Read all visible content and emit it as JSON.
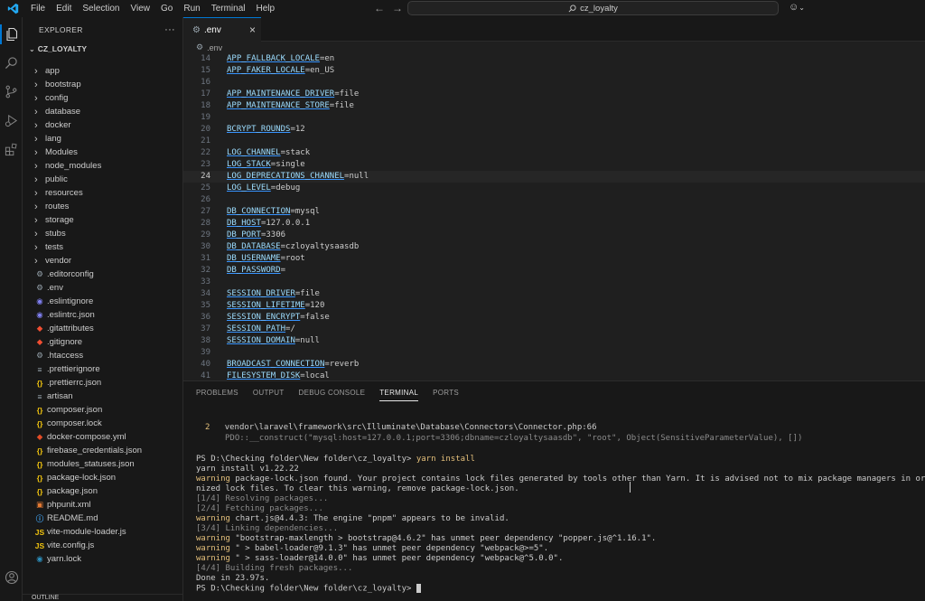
{
  "titlebar": {
    "menu": [
      "File",
      "Edit",
      "Selection",
      "View",
      "Go",
      "Run",
      "Terminal",
      "Help"
    ],
    "search": "cz_loyalty",
    "icons": [
      "vscode-logo-icon",
      "arrow-left-icon",
      "arrow-right-icon",
      "search-icon",
      "copilot-icon",
      "chevron-down-icon"
    ]
  },
  "sidebar": {
    "title": "EXPLORER",
    "more": "···",
    "root": "CZ_LOYALTY",
    "items": [
      {
        "label": "app",
        "type": "folder"
      },
      {
        "label": "bootstrap",
        "type": "folder"
      },
      {
        "label": "config",
        "type": "folder"
      },
      {
        "label": "database",
        "type": "folder"
      },
      {
        "label": "docker",
        "type": "folder"
      },
      {
        "label": "lang",
        "type": "folder"
      },
      {
        "label": "Modules",
        "type": "folder"
      },
      {
        "label": "node_modules",
        "type": "folder"
      },
      {
        "label": "public",
        "type": "folder"
      },
      {
        "label": "resources",
        "type": "folder"
      },
      {
        "label": "routes",
        "type": "folder"
      },
      {
        "label": "storage",
        "type": "folder"
      },
      {
        "label": "stubs",
        "type": "folder"
      },
      {
        "label": "tests",
        "type": "folder"
      },
      {
        "label": "vendor",
        "type": "folder"
      },
      {
        "label": ".editorconfig",
        "type": "gear"
      },
      {
        "label": ".env",
        "type": "gear"
      },
      {
        "label": ".eslintignore",
        "type": "eslint"
      },
      {
        "label": ".eslintrc.json",
        "type": "eslint"
      },
      {
        "label": ".gitattributes",
        "type": "git"
      },
      {
        "label": ".gitignore",
        "type": "git"
      },
      {
        "label": ".htaccess",
        "type": "gear"
      },
      {
        "label": ".prettierignore",
        "type": "lines"
      },
      {
        "label": ".prettierrc.json",
        "type": "json"
      },
      {
        "label": "artisan",
        "type": "lines"
      },
      {
        "label": "composer.json",
        "type": "json"
      },
      {
        "label": "composer.lock",
        "type": "json"
      },
      {
        "label": "docker-compose.yml",
        "type": "yml"
      },
      {
        "label": "firebase_credentials.json",
        "type": "json"
      },
      {
        "label": "modules_statuses.json",
        "type": "json"
      },
      {
        "label": "package-lock.json",
        "type": "json"
      },
      {
        "label": "package.json",
        "type": "json"
      },
      {
        "label": "phpunit.xml",
        "type": "xml"
      },
      {
        "label": "README.md",
        "type": "info"
      },
      {
        "label": "vite-module-loader.js",
        "type": "js"
      },
      {
        "label": "vite.config.js",
        "type": "js"
      },
      {
        "label": "yarn.lock",
        "type": "yarn"
      }
    ],
    "outline": "OUTLINE"
  },
  "editor": {
    "tab_label": ".env",
    "breadcrumb": ".env",
    "current_line": 24,
    "lines": [
      {
        "n": "14",
        "k": "APP_FALLBACK_LOCALE",
        "v": "=en"
      },
      {
        "n": "15",
        "k": "APP_FAKER_LOCALE",
        "v": "=en_US"
      },
      {
        "n": "16",
        "k": "",
        "v": ""
      },
      {
        "n": "17",
        "k": "APP_MAINTENANCE_DRIVER",
        "v": "=file"
      },
      {
        "n": "18",
        "k": "APP_MAINTENANCE_STORE",
        "v": "=file"
      },
      {
        "n": "19",
        "k": "",
        "v": ""
      },
      {
        "n": "20",
        "k": "BCRYPT_ROUNDS",
        "v": "=12"
      },
      {
        "n": "21",
        "k": "",
        "v": ""
      },
      {
        "n": "22",
        "k": "LOG_CHANNEL",
        "v": "=stack"
      },
      {
        "n": "23",
        "k": "LOG_STACK",
        "v": "=single"
      },
      {
        "n": "24",
        "k": "LOG_DEPRECATIONS_CHANNEL",
        "v": "=null"
      },
      {
        "n": "25",
        "k": "LOG_LEVEL",
        "v": "=debug"
      },
      {
        "n": "26",
        "k": "",
        "v": ""
      },
      {
        "n": "27",
        "k": "DB_CONNECTION",
        "v": "=mysql"
      },
      {
        "n": "28",
        "k": "DB_HOST",
        "v": "=127.0.0.1"
      },
      {
        "n": "29",
        "k": "DB_PORT",
        "v": "=3306"
      },
      {
        "n": "30",
        "k": "DB_DATABASE",
        "v": "=czloyaltysaasdb"
      },
      {
        "n": "31",
        "k": "DB_USERNAME",
        "v": "=root"
      },
      {
        "n": "32",
        "k": "DB_PASSWORD",
        "v": "="
      },
      {
        "n": "33",
        "k": "",
        "v": ""
      },
      {
        "n": "34",
        "k": "SESSION_DRIVER",
        "v": "=file"
      },
      {
        "n": "35",
        "k": "SESSION_LIFETIME",
        "v": "=120"
      },
      {
        "n": "36",
        "k": "SESSION_ENCRYPT",
        "v": "=false"
      },
      {
        "n": "37",
        "k": "SESSION_PATH",
        "v": "=/"
      },
      {
        "n": "38",
        "k": "SESSION_DOMAIN",
        "v": "=null"
      },
      {
        "n": "39",
        "k": "",
        "v": ""
      },
      {
        "n": "40",
        "k": "BROADCAST_CONNECTION",
        "v": "=reverb"
      },
      {
        "n": "41",
        "k": "FILESYSTEM_DISK",
        "v": "=local"
      }
    ]
  },
  "panel": {
    "tabs": [
      "PROBLEMS",
      "OUTPUT",
      "DEBUG CONSOLE",
      "TERMINAL",
      "PORTS"
    ],
    "active_tab": "TERMINAL",
    "terminal": {
      "trace_num": "2",
      "trace_path": "vendor\\laravel\\framework\\src\\Illuminate\\Database\\Connectors\\Connector.php:66",
      "trace_call": "PDO::__construct(\"mysql:host=127.0.0.1;port=3306;dbname=czloyaltysaasdb\", \"root\", Object(SensitiveParameterValue), [])",
      "prompt1": "PS D:\\Checking folder\\New folder\\cz_loyalty> ",
      "cmd": "yarn install",
      "yarn_version": "yarn install v1.22.22",
      "warning": "warning",
      "warn1": " package-lock.json found. Your project contains lock files generated by tools other than Yarn. It is advised not to mix package managers in order to avoid resolut",
      "warn1b": "nized lock files. To clear this warning, remove package-lock.json.",
      "step1": "[1/4] Resolving packages...",
      "step2": "[2/4] Fetching packages...",
      "warn2": " chart.js@4.4.3: The engine \"pnpm\" appears to be invalid.",
      "step3": "[3/4] Linking dependencies...",
      "warn3": " \"bootstrap-maxlength > bootstrap@4.6.2\" has unmet peer dependency \"popper.js@^1.16.1\".",
      "warn4": " \" > babel-loader@9.1.3\" has unmet peer dependency \"webpack@>=5\".",
      "warn5": " \" > sass-loader@14.0.0\" has unmet peer dependency \"webpack@^5.0.0\".",
      "step4": "[4/4] Building fresh packages...",
      "done": "Done in 23.97s.",
      "prompt2": "PS D:\\Checking folder\\New folder\\cz_loyalty> "
    }
  },
  "colors": {
    "accent": "#0078d4",
    "warning": "#e5c07b",
    "key": "#9cdcfe"
  }
}
